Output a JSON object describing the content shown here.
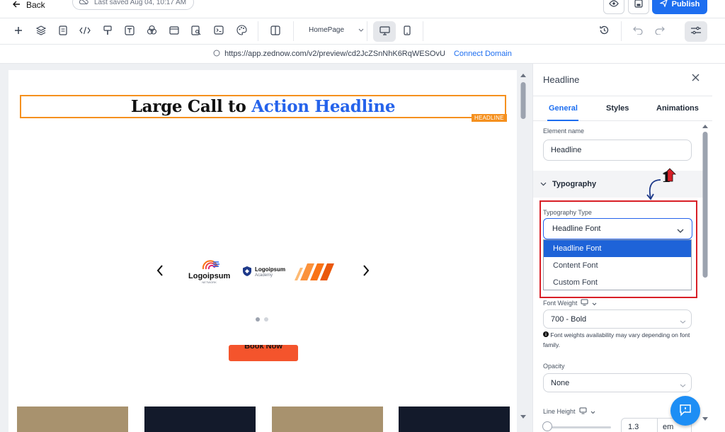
{
  "topbar": {
    "back_label": "Back",
    "last_saved": "Last saved Aug 04, 10:17 AM",
    "publish_label": "Publish"
  },
  "toolbar": {
    "page_selector": "HomePage"
  },
  "url": {
    "address": "https://app.zednow.com/v2/preview/cd2JcZSnNhK6RqWESOvU",
    "connect_domain": "Connect Domain"
  },
  "canvas": {
    "headline_main": "Large Call to ",
    "headline_accent": "Action Headline",
    "headline_tag": "HEADLINE",
    "logo1_text": "Logoipsum",
    "logo1_sub": "NETWORK",
    "logo2_text": "Logoipsum",
    "logo2_sub": "Academy",
    "book_now": "Book Now"
  },
  "panel": {
    "title": "Headline",
    "tabs": [
      "General",
      "Styles",
      "Animations"
    ],
    "element_name_label": "Element name",
    "element_name_value": "Headline",
    "typography_section": "Typography",
    "typography_type_label": "Typography Type",
    "typography_type_value": "Headline Font",
    "typography_options": [
      "Headline Font",
      "Content Font",
      "Custom Font"
    ],
    "font_weight_label": "Font Weight",
    "font_weight_value": "700 - Bold",
    "font_weight_note": "Font weights availability may vary depending on font family.",
    "opacity_label": "Opacity",
    "opacity_value": "None",
    "line_height_label": "Line Height",
    "line_height_value": "1.3",
    "line_height_unit": "em"
  },
  "annotation": {
    "step_number": "1"
  },
  "colors": {
    "accent": "#1d6ef0",
    "highlight_orange": "#f5901e",
    "book_button": "#f4542c",
    "annotation_red": "#d81f26"
  }
}
